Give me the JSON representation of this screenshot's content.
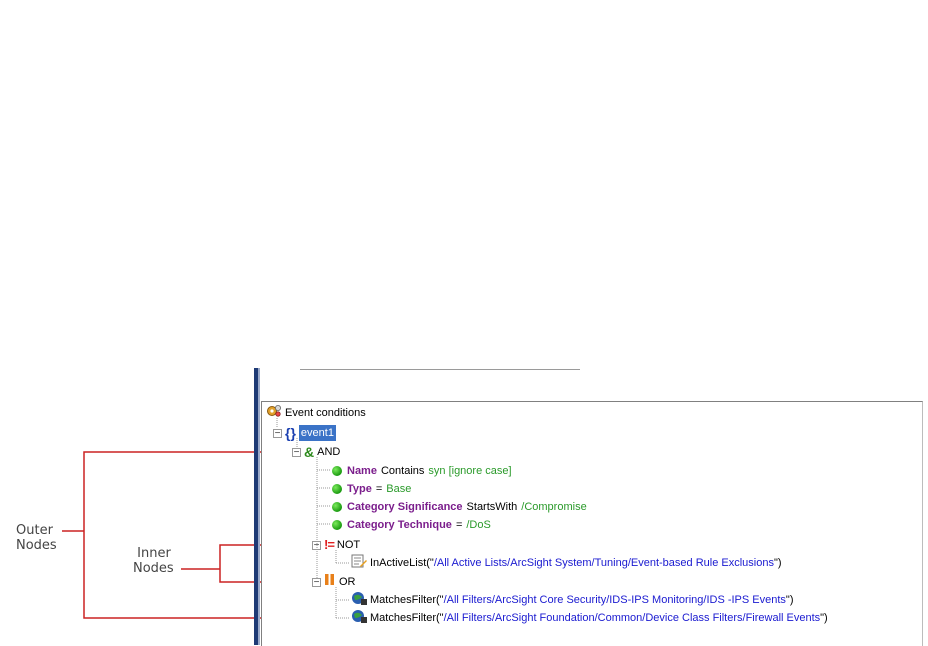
{
  "annotations": {
    "outer": "Outer\nNodes",
    "inner": "Inner\nNodes"
  },
  "tree": {
    "root_label": "Event conditions",
    "event_label": "event1",
    "and_label": "AND",
    "conditions": [
      {
        "field": "Name",
        "op": "Contains",
        "value": "syn [ignore case]"
      },
      {
        "field": "Type",
        "op": "=",
        "value": "Base"
      },
      {
        "field": "Category Significance",
        "op": "StartsWith",
        "value": "/Compromise"
      },
      {
        "field": "Category Technique",
        "op": "=",
        "value": "/DoS"
      }
    ],
    "not_label": "NOT",
    "inactive_func": "InActiveList(\"",
    "inactive_path": "/All Active Lists/ArcSight System/Tuning/Event-based Rule Exclusions",
    "inactive_end": "\")",
    "or_label": "OR",
    "filter1_func": "MatchesFilter(\"",
    "filter1_path": "/All Filters/ArcSight Core Security/IDS-IPS Monitoring/IDS -IPS Events",
    "filter1_end": "\")",
    "filter2_func": "MatchesFilter(\"",
    "filter2_path": "/All Filters/ArcSight Foundation/Common/Device Class Filters/Firewall Events",
    "filter2_end": "\")"
  },
  "colors": {
    "keyword": "#7b1e8c",
    "value": "#2a9a2a",
    "string": "#1a1ad0",
    "annotation_line": "#cc2222",
    "selection": "#3b73c7"
  }
}
